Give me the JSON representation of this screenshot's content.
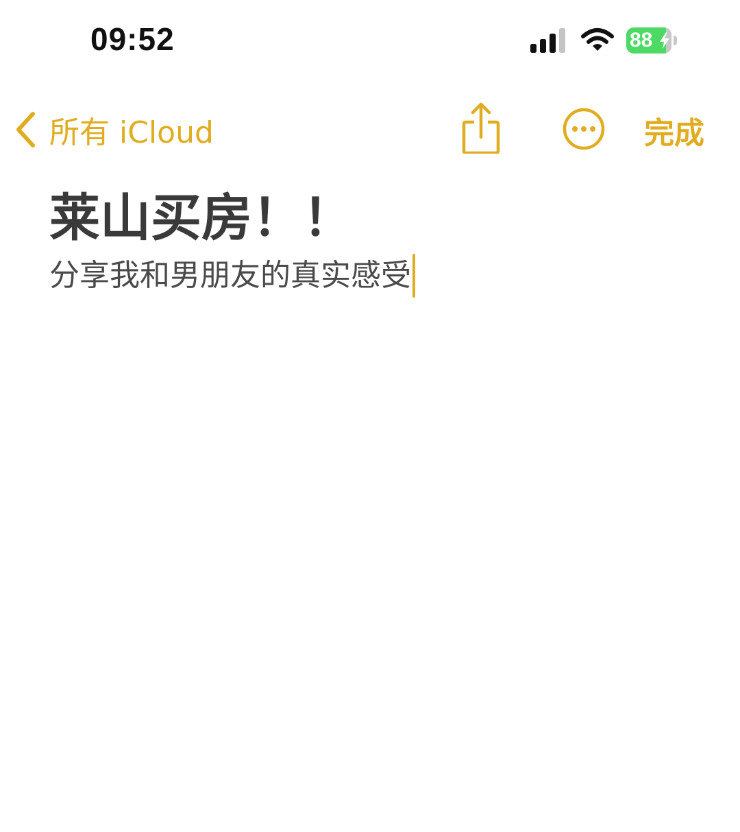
{
  "status_bar": {
    "time": "09:52",
    "battery_percent": "88",
    "battery_level": 0.88,
    "icons": [
      "cellular-signal-icon",
      "wifi-icon",
      "battery-icon",
      "charging-bolt-icon"
    ]
  },
  "nav": {
    "back_label": "所有 iCloud",
    "back_icon": "chevron-left-icon",
    "share_icon": "share-icon",
    "more_icon": "ellipsis-circle-icon",
    "done_label": "完成"
  },
  "note": {
    "title": "莱山买房！！",
    "body": "分享我和男朋友的真实感受"
  },
  "colors": {
    "accent": "#e0ac20",
    "title_text": "#3a3a3a",
    "body_text": "#4a4a4a",
    "battery_green": "#4cd964",
    "background": "#ffffff"
  }
}
